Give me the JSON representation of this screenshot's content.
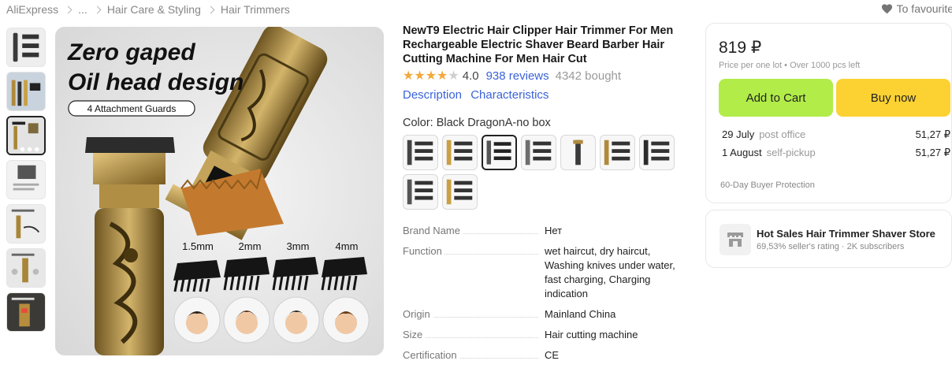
{
  "breadcrumb": [
    "AliExpress",
    "...",
    "Hair Care & Styling",
    "Hair Trimmers"
  ],
  "favourite_label": "To favourite",
  "main_image": {
    "headline_line1": "Zero gaped",
    "headline_line2": "Oil head design",
    "badge": "4 Attachment Guards",
    "guards": [
      "1.5mm",
      "2mm",
      "3mm",
      "4mm"
    ]
  },
  "product": {
    "title": "NewT9 Electric Hair Clipper Hair Trimmer For Men Rechargeable Electric Shaver Beard Barber Hair Cutting Machine For Men Hair Cut",
    "rating": "4.0",
    "rating_value": 4.0,
    "reviews": "938 reviews",
    "bought": "4342 bought",
    "tab_description": "Description",
    "tab_characteristics": "Characteristics",
    "color_label": "Color: Black DragonA-no box",
    "selected_swatch_index": 2
  },
  "specs": [
    {
      "key": "Brand Name",
      "value": "Нет"
    },
    {
      "key": "Function",
      "value": "wet haircut, dry haircut, Washing knives under water, fast charging, Charging indication"
    },
    {
      "key": "Origin",
      "value": "Mainland China"
    },
    {
      "key": "Size",
      "value": "Hair cutting machine"
    },
    {
      "key": "Certification",
      "value": "CE"
    }
  ],
  "buybox": {
    "price": "819 ₽",
    "price_sub": "Price per one lot • Over 1000 pcs left",
    "add_to_cart": "Add to Cart",
    "buy_now": "Buy now",
    "shipping": [
      {
        "date": "29 July",
        "method": "post office",
        "price": "51,27 ₽"
      },
      {
        "date": "1 August",
        "method": "self-pickup",
        "price": "51,27 ₽"
      }
    ],
    "protection": "60-Day Buyer Protection"
  },
  "store": {
    "name": "Hot Sales Hair Trimmer Shaver Store",
    "rating": "69,53% seller's rating",
    "subscribers": "2K subscribers"
  },
  "colors": {
    "link": "#3b63d8",
    "star": "#f2a93b",
    "cart_button": "#b2ec48",
    "buy_button": "#fcd232"
  }
}
